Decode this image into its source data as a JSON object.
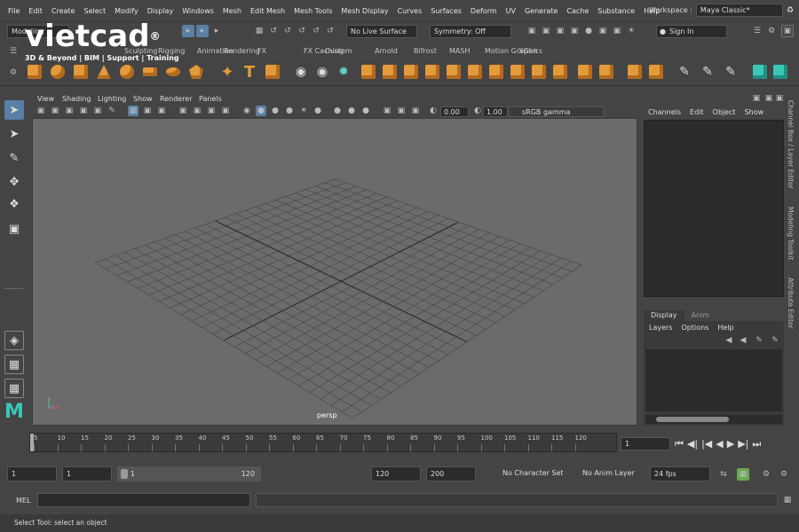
{
  "menu": [
    "File",
    "Edit",
    "Create",
    "Select",
    "Modify",
    "Display",
    "Windows",
    "Mesh",
    "Edit Mesh",
    "Mesh Tools",
    "Mesh Display",
    "Curves",
    "Surfaces",
    "Deform",
    "UV",
    "Generate",
    "Cache",
    "Substance",
    "Help"
  ],
  "workspace": {
    "label": "Workspace :",
    "value": "Maya Classic*"
  },
  "status": {
    "mode": "Modeling",
    "live_surface": "No Live Surface",
    "symmetry": "Symmetry: Off",
    "sign_in": "Sign In"
  },
  "logo": {
    "brand": "vietcad",
    "reg": "®",
    "tagline": "3D & Beyond | BIM | Support | Training"
  },
  "shelf_tabs": [
    "Sculpting",
    "Rigging",
    "Animation",
    "Rendering",
    "FX",
    "FX Caching",
    "Custom",
    "Arnold",
    "Bifrost",
    "MASH",
    "Motion Graphics",
    "XGen"
  ],
  "viewport": {
    "menus": [
      "View",
      "Shading",
      "Lighting",
      "Show",
      "Renderer",
      "Panels"
    ],
    "exposure": "0.00",
    "gamma": "1.00",
    "color_space": "sRGB gamma",
    "camera": "persp"
  },
  "channel_box": {
    "menus": [
      "Channels",
      "Edit",
      "Object",
      "Show"
    ]
  },
  "layer_editor": {
    "tabs": [
      "Display",
      "Anim"
    ],
    "menus": [
      "Layers",
      "Options",
      "Help"
    ]
  },
  "side_tabs": [
    "Channel Box / Layer Editor",
    "Modeling Toolkit",
    "Attribute Editor"
  ],
  "timeline": {
    "ticks": [
      "5",
      "10",
      "15",
      "20",
      "25",
      "30",
      "35",
      "40",
      "45",
      "50",
      "55",
      "60",
      "65",
      "70",
      "75",
      "80",
      "85",
      "90",
      "95",
      "100",
      "105",
      "110",
      "115",
      "120"
    ],
    "current": "1"
  },
  "range": {
    "start": "1",
    "anim_start": "1",
    "slider_start": "1",
    "slider_end": "120",
    "end": "120",
    "anim_end": "200",
    "char_set": "No Character Set",
    "anim_layer": "No Anim Layer",
    "fps": "24 fps"
  },
  "mel": {
    "label": "MEL"
  },
  "help": "Select Tool: select an object",
  "colors": {
    "accent_orange": "#e39a3a",
    "accent_teal": "#5fd1c6",
    "maya_logo": "#3ac8b6"
  }
}
